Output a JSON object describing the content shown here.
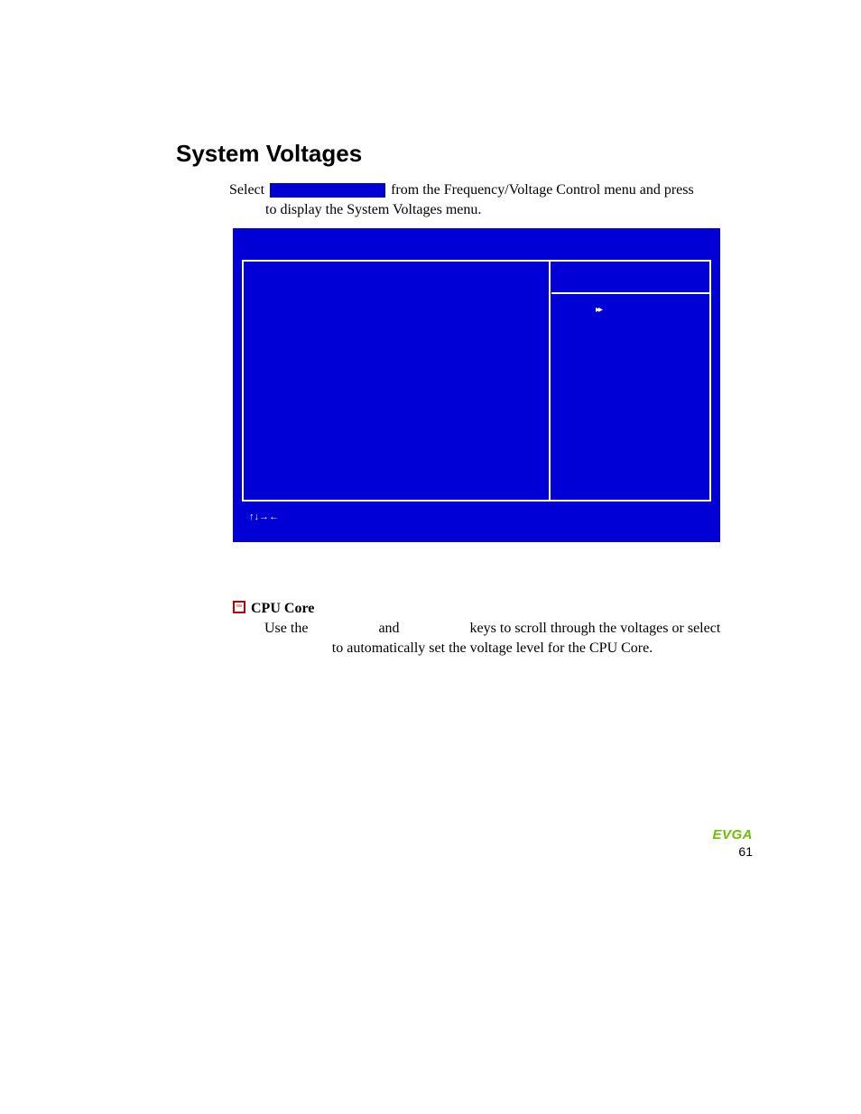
{
  "heading": "System Voltages",
  "intro": {
    "select_word": "Select",
    "after_box": " from the Frequency/Voltage Control menu and press",
    "line2": "to display the System Voltages menu."
  },
  "bios": {
    "arrows_glyph": "▸▸",
    "nav_glyphs": "↑↓→←"
  },
  "item": {
    "title": "CPU Core",
    "body_prefix": "Use the ",
    "body_mid": " and ",
    "body_after": " keys to scroll through the voltages or select",
    "body_line2": "to automatically set the voltage level for the CPU Core."
  },
  "footer": {
    "brand": "EVGA",
    "page": "61"
  }
}
